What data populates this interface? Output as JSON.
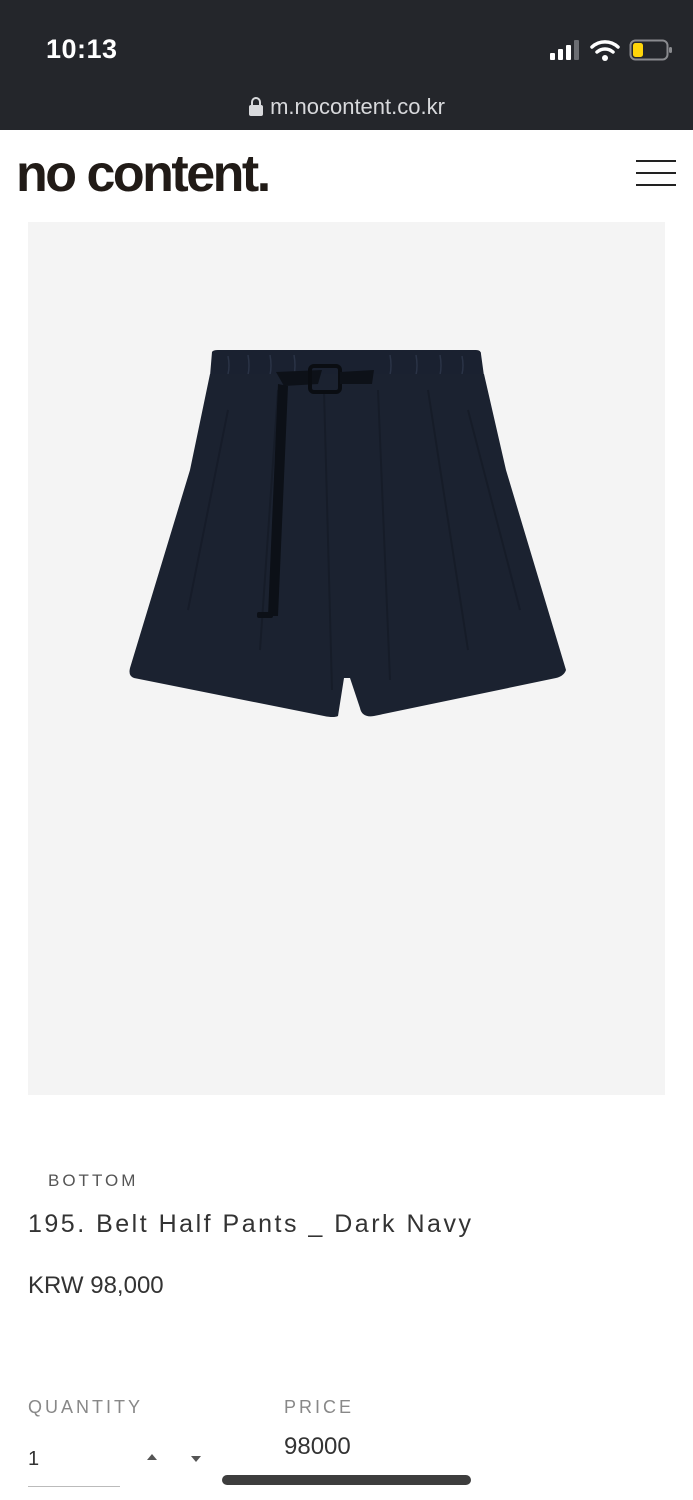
{
  "status_bar": {
    "time": "10:13",
    "icons": [
      "signal-icon",
      "wifi-icon",
      "battery-icon"
    ],
    "battery_color": "#ffd60a"
  },
  "browser": {
    "url": "m.nocontent.co.kr",
    "lock_icon": "lock-icon"
  },
  "header": {
    "logo": "no content.",
    "menu_icon": "hamburger-menu-icon"
  },
  "product": {
    "image_alt_icon": "shorts-image",
    "image_background": "#f4f4f4",
    "category": "BOTTOM",
    "name": "195. Belt Half Pants _ Dark Navy",
    "price": "KRW 98,000",
    "garment_color": "#1b2230"
  },
  "order": {
    "quantity_label": "QUANTITY",
    "quantity_value": "1",
    "price_label": "PRICE",
    "price_value": "98000"
  },
  "colors": {
    "chrome_background": "#24262b",
    "text_primary": "#333333",
    "text_muted": "#888888"
  }
}
